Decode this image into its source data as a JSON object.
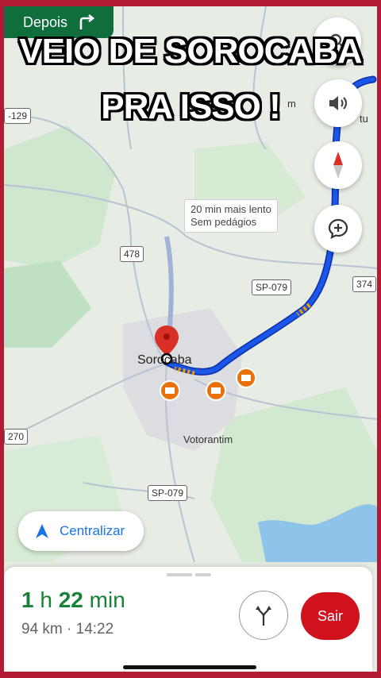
{
  "overlay_caption": {
    "line1": "VEIO DE SOROCABA",
    "line2": "PRA ISSO !"
  },
  "next_turn": {
    "label": "Depois"
  },
  "map": {
    "places": {
      "city": "Sorocaba",
      "district": "Votorantim",
      "partial_right_top": "tu",
      "partial_right_mid": "m"
    },
    "road_shields": {
      "r129": "-129",
      "r478": "478",
      "sp079_north": "SP-079",
      "r374": "374",
      "r270": "270",
      "sp079_south": "SP-079"
    },
    "traffic_note": {
      "line1": "20 min mais lento",
      "line2": "Sem pedágios"
    },
    "colors": {
      "route": "#1a56e8",
      "route_outline": "#0b2ea8",
      "traffic_slow": "#f29900",
      "land": "#dfe9da",
      "water": "#8fc4ea"
    }
  },
  "controls": {
    "volume": "volume-icon",
    "compass": "compass-icon",
    "report": "report-add-icon",
    "recenter_label": "Centralizar"
  },
  "trip": {
    "hours": "1",
    "hours_unit": " h ",
    "minutes": "22",
    "minutes_unit": " min",
    "distance": "94 km",
    "separator": " · ",
    "arrival": "14:22",
    "exit_label": "Sair"
  }
}
